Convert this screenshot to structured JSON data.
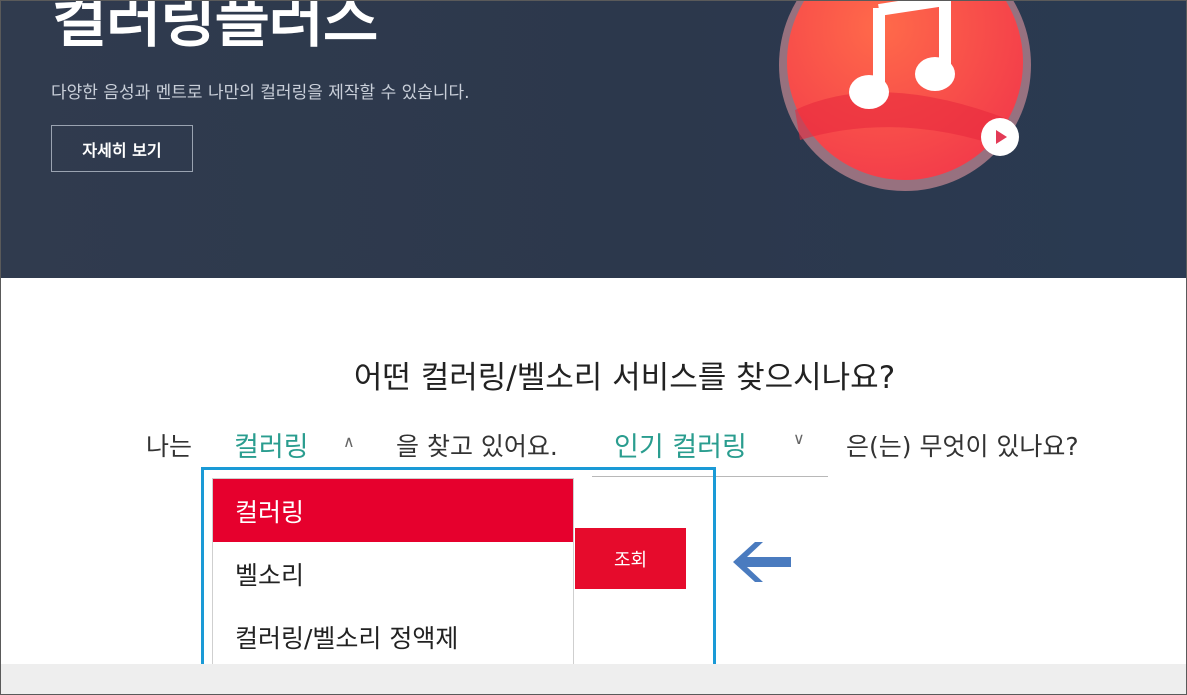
{
  "hero": {
    "title": "컬러링플러스",
    "subtitle": "다양한 음성과 멘트로 나만의 컬러링을 제작할 수 있습니다.",
    "detail_button": "자세히 보기"
  },
  "search": {
    "question": "어떤 컬러링/벨소리 서비스를 찾으시나요?",
    "prefix": "나는",
    "selected_type": "컬러링",
    "middle": "을 찾고 있어요.",
    "selected_category": "인기 컬러링",
    "suffix": "은(는) 무엇이 있나요?",
    "query_button": "조회",
    "type_options": [
      "컬러링",
      "벨소리",
      "컬러링/벨소리 정액제"
    ]
  },
  "colors": {
    "accent_red": "#e60b2c",
    "accent_teal": "#2a9d8f",
    "highlight_blue": "#1a9ad6",
    "arrow_blue": "#4a7bbf",
    "hero_bg": "#2f3a4d"
  },
  "icons": {
    "caret_up": "chevron-up-icon",
    "caret_down": "chevron-down-icon",
    "annotation": "arrow-left-icon",
    "music": "music-note-icon",
    "play": "play-icon"
  }
}
